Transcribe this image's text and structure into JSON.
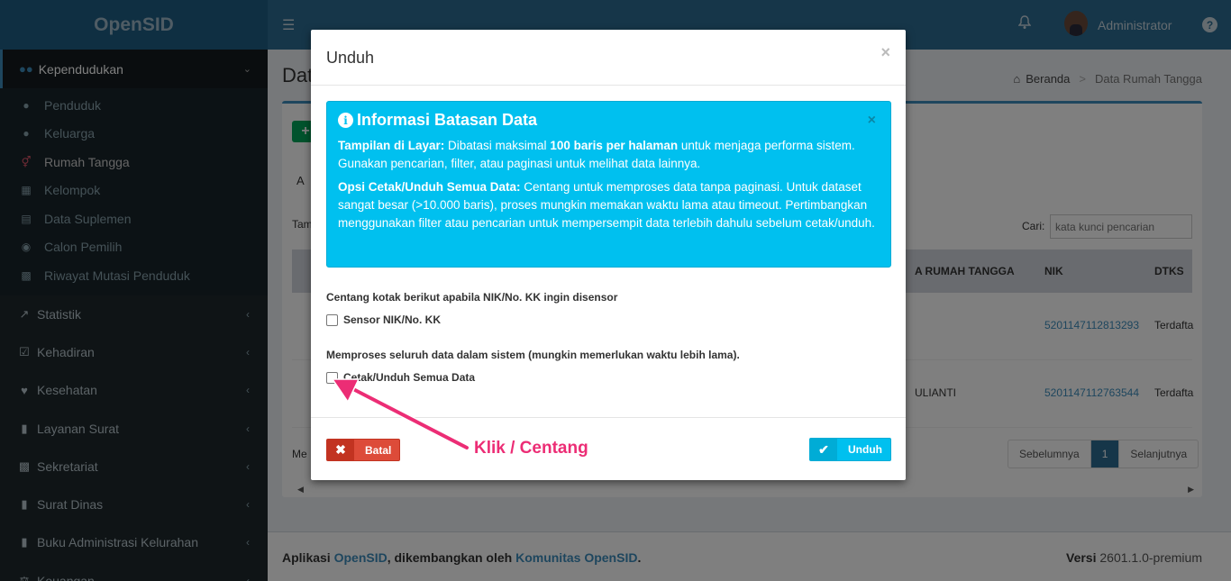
{
  "app": {
    "logo": "OpenSID"
  },
  "sidebar": {
    "active_group": "Kependudukan",
    "sub_items": [
      {
        "label": "Penduduk",
        "icon": "user-icon"
      },
      {
        "label": "Keluarga",
        "icon": "users-icon"
      },
      {
        "label": "Rumah Tangga",
        "icon": "venus-mars-icon"
      },
      {
        "label": "Kelompok",
        "icon": "sitemap-icon"
      },
      {
        "label": "Data Suplemen",
        "icon": "credit-card-icon"
      },
      {
        "label": "Calon Pemilih",
        "icon": "dashboard-icon"
      },
      {
        "label": "Riwayat Mutasi Penduduk",
        "icon": "archive-icon"
      }
    ],
    "items": [
      {
        "label": "Statistik",
        "icon": "line-chart-icon"
      },
      {
        "label": "Kehadiran",
        "icon": "calendar-check-icon"
      },
      {
        "label": "Kesehatan",
        "icon": "heartbeat-icon"
      },
      {
        "label": "Layanan Surat",
        "icon": "book-icon"
      },
      {
        "label": "Sekretariat",
        "icon": "archive-icon"
      },
      {
        "label": "Surat Dinas",
        "icon": "book-icon"
      },
      {
        "label": "Buku Administrasi Kelurahan",
        "icon": "book-icon"
      },
      {
        "label": "Keuangan",
        "icon": "balance-scale-icon"
      }
    ]
  },
  "header": {
    "user": "Administrator"
  },
  "page": {
    "title_fragment": "Dat",
    "breadcrumb": {
      "home": "Beranda",
      "current": "Data Rumah Tangga"
    },
    "frag_a": "A",
    "frag_tam": "Tam",
    "search_label": "Cari:",
    "search_placeholder": "kata kunci pencarian",
    "frag_me": "Me",
    "columns": {
      "kepala": "A RUMAH TANGGA",
      "nik": "NIK",
      "dtks": "DTKS"
    },
    "rows": [
      {
        "nama": "",
        "nik": "5201147112813293",
        "dtks": "Terdafta"
      },
      {
        "nama": "ULIANTI",
        "nik": "5201147112763544",
        "dtks": "Terdafta"
      }
    ],
    "pager": {
      "prev": "Sebelumnya",
      "page": "1",
      "next": "Selanjutnya"
    }
  },
  "footer": {
    "prefix": "Aplikasi",
    "app_link": "OpenSID",
    "middle": ", dikembangkan oleh",
    "community_link": "Komunitas OpenSID",
    "suffix": ".",
    "version_label": "Versi",
    "version": "2601.1.0-premium"
  },
  "modal": {
    "title": "Unduh",
    "close": "×",
    "callout": {
      "title": "Informasi Batasan Data",
      "p1_bold": "Tampilan di Layar:",
      "p1_a": " Dibatasi maksimal ",
      "p1_bold2": "100 baris per halaman",
      "p1_b": " untuk menjaga performa sistem. Gunakan pencarian, filter, atau paginasi untuk melihat data lainnya.",
      "p2_bold": "Opsi Cetak/Unduh Semua Data:",
      "p2_text": " Centang untuk memproses data tanpa paginasi. Untuk dataset sangat besar (>10.000 baris), proses mungkin memakan waktu lama atau timeout. Pertimbangkan menggunakan filter atau pencarian untuk mempersempit data terlebih dahulu sebelum cetak/unduh."
    },
    "sensor_label": "Centang kotak berikut apabila NIK/No. KK ingin disensor",
    "sensor_checkbox": "Sensor NIK/No. KK",
    "all_label": "Memproses seluruh data dalam sistem (mungkin memerlukan waktu lebih lama).",
    "all_checkbox": "Cetak/Unduh Semua Data",
    "btn_cancel": "Batal",
    "btn_download": "Unduh"
  },
  "annotation": {
    "text": "Klik / Centang",
    "color": "#ec2d75"
  },
  "colors": {
    "header": "#2c6c92",
    "sidebar": "#1e282c",
    "info": "#00c0ef",
    "danger": "#dd4b39",
    "link": "#3c8dbc"
  }
}
